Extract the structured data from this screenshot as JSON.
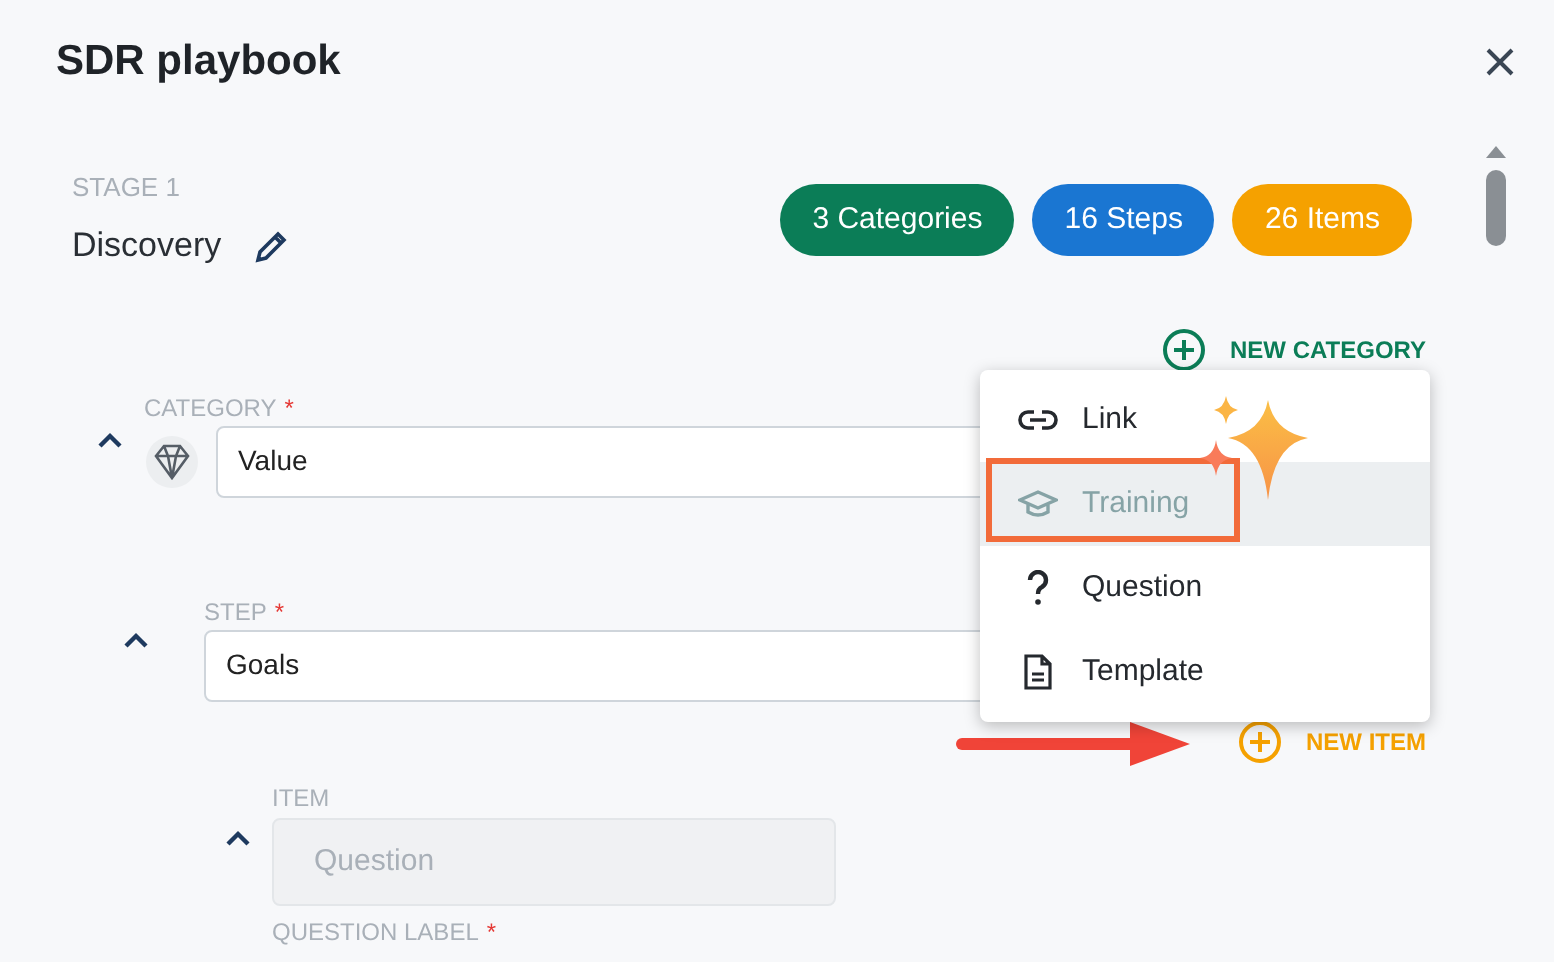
{
  "dialog": {
    "title": "SDR playbook"
  },
  "stage": {
    "label": "STAGE 1",
    "name": "Discovery"
  },
  "badges": [
    {
      "text": "3 Categories",
      "color": "#0b7d57"
    },
    {
      "text": "16 Steps",
      "color": "#1a76d2"
    },
    {
      "text": "26 Items",
      "color": "#f5a100"
    }
  ],
  "new_category": {
    "label": "NEW CATEGORY"
  },
  "category": {
    "label": "CATEGORY",
    "required_mark": "*",
    "value": "Value",
    "expanded": true
  },
  "step": {
    "label": "STEP",
    "required_mark": "*",
    "value": "Goals",
    "expanded": true
  },
  "new_item": {
    "label": "NEW ITEM"
  },
  "item": {
    "label": "ITEM",
    "placeholder": "Question",
    "disabled": true,
    "expanded": true
  },
  "question_label": {
    "label": "QUESTION LABEL",
    "required_mark": "*"
  },
  "menu": {
    "items": [
      {
        "kind": "link",
        "label": "Link",
        "selected": false
      },
      {
        "kind": "training",
        "label": "Training",
        "selected": true
      },
      {
        "kind": "question",
        "label": "Question",
        "selected": false
      },
      {
        "kind": "template",
        "label": "Template",
        "selected": false
      }
    ]
  }
}
